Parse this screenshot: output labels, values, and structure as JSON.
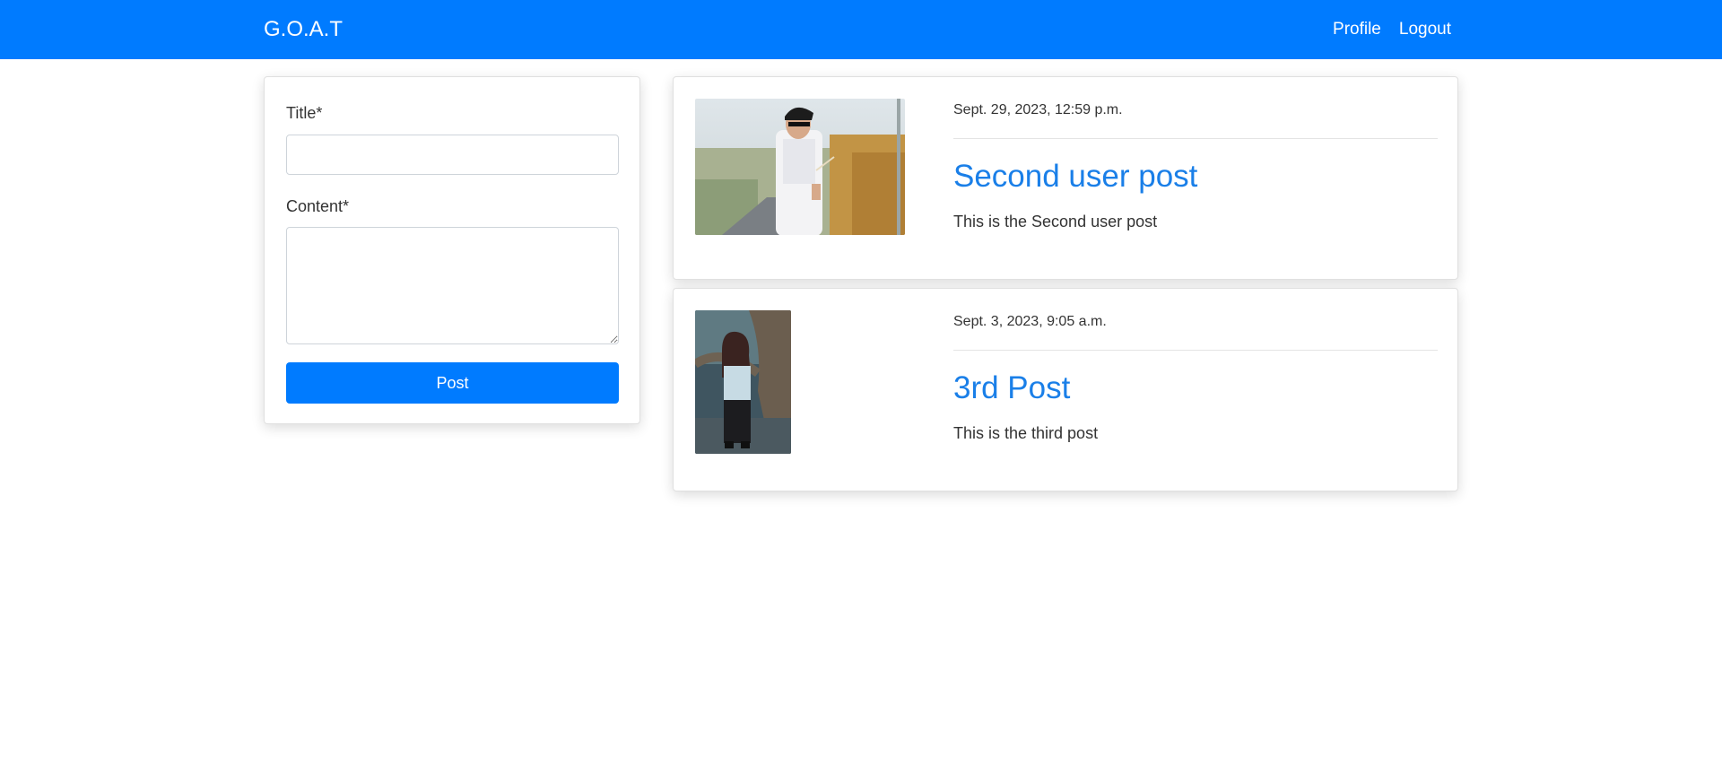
{
  "navbar": {
    "brand": "G.O.A.T",
    "links": [
      "Profile",
      "Logout"
    ],
    "color": "#007bff"
  },
  "form": {
    "title_label": "Title*",
    "title_value": "",
    "content_label": "Content*",
    "content_value": "",
    "submit_label": "Post"
  },
  "posts": [
    {
      "date": "Sept. 29, 2023, 12:59 p.m.",
      "title": "Second user post",
      "body": "This is the Second user post",
      "image_icon": "photo-man-in-field"
    },
    {
      "date": "Sept. 3, 2023, 9:05 a.m.",
      "title": "3rd Post",
      "body": "This is the third post",
      "image_icon": "photo-woman-by-tree"
    }
  ],
  "colors": {
    "accent": "#007bff",
    "post_title": "#1a7fe8"
  }
}
